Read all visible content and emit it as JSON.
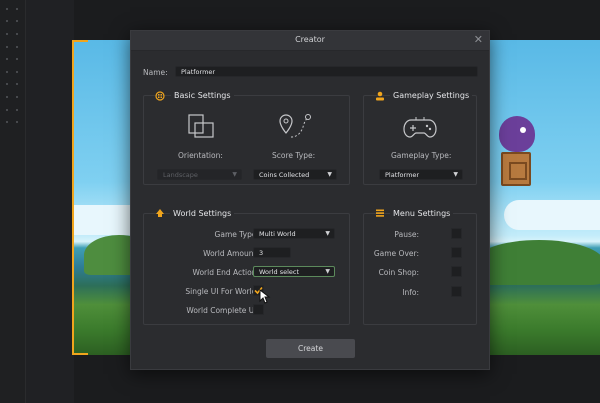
{
  "modal": {
    "title": "Creator",
    "name_label": "Name:",
    "name_value": "Platformer",
    "create_label": "Create"
  },
  "basic": {
    "title": "Basic Settings",
    "orientation_label": "Orientation:",
    "orientation_value": "Landscape",
    "score_label": "Score Type:",
    "score_value": "Coins Collected"
  },
  "gameplay": {
    "title": "Gameplay Settings",
    "type_label": "Gameplay Type:",
    "type_value": "Platformer"
  },
  "world": {
    "title": "World Settings",
    "game_type_label": "Game Type:",
    "game_type_value": "Multi World",
    "amount_label": "World Amount:",
    "amount_value": "3",
    "end_action_label": "World End Action:",
    "end_action_value": "World select",
    "single_ui_label": "Single UI For World:",
    "complete_ui_label": "World Complete UI:"
  },
  "menu": {
    "title": "Menu Settings",
    "pause_label": "Pause:",
    "gameover_label": "Game Over:",
    "coinshop_label": "Coin Shop:",
    "info_label": "Info:"
  },
  "colors": {
    "accent": "#f0a51d",
    "modal_bg": "#2b2c2f",
    "field_bg": "#1e1f21"
  }
}
